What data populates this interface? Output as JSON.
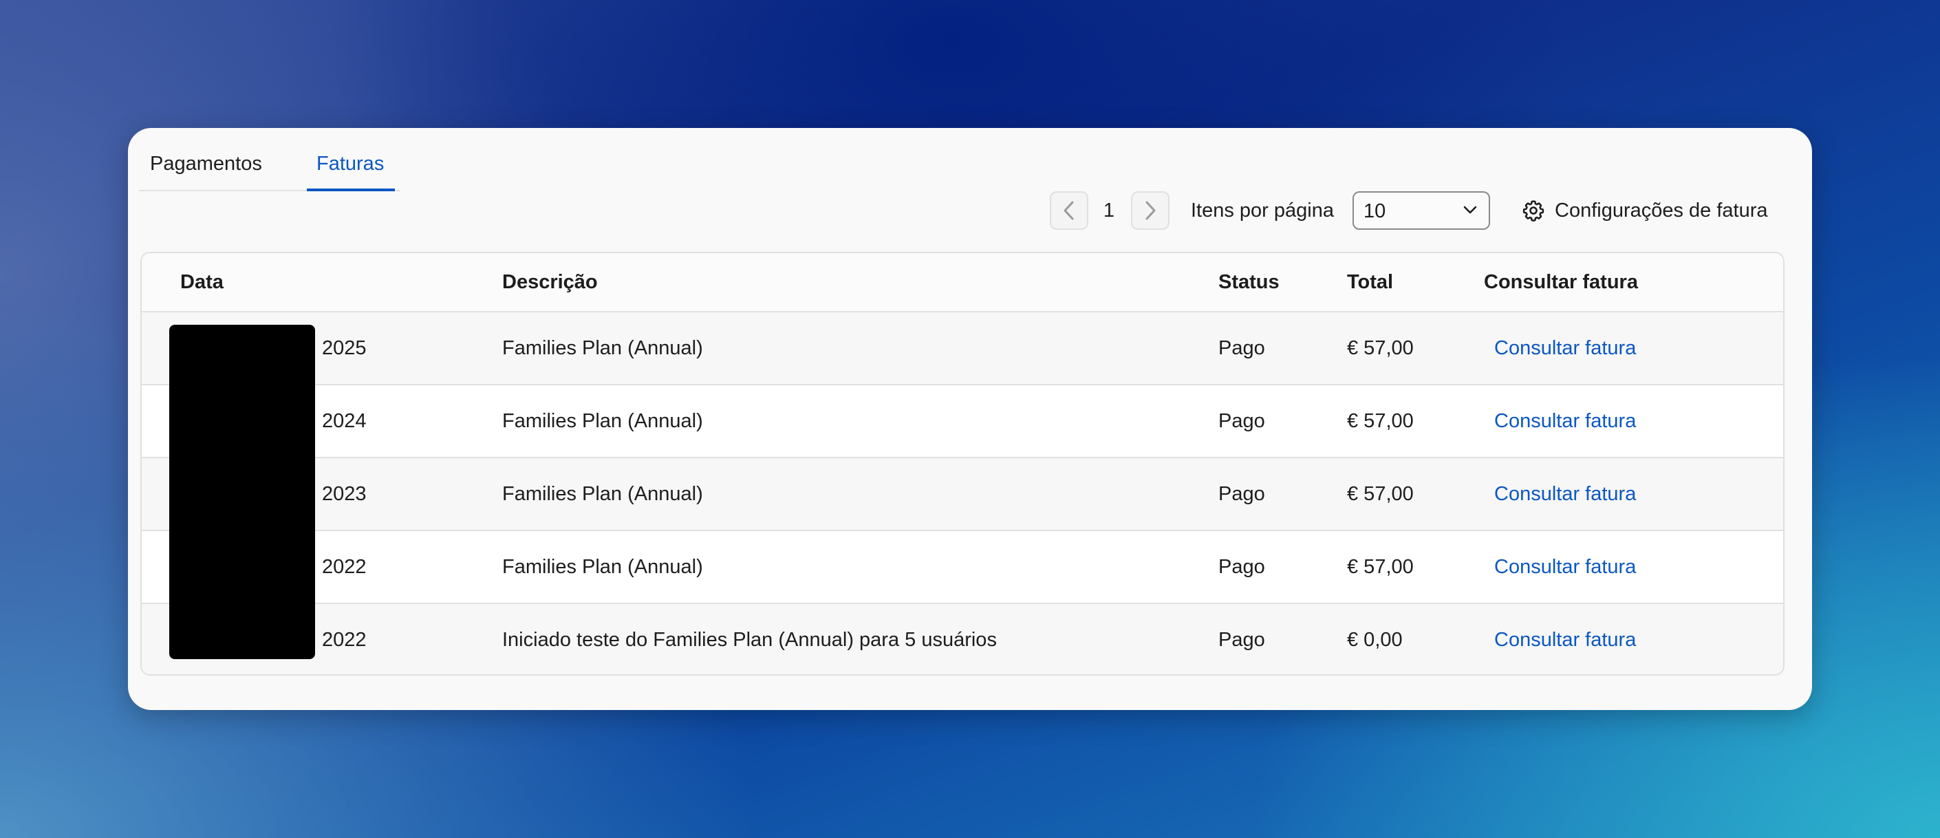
{
  "tabs": [
    {
      "label": "Pagamentos",
      "active": false
    },
    {
      "label": "Faturas",
      "active": true
    }
  ],
  "pagination": {
    "current_page": "1",
    "items_per_page_label": "Itens por página",
    "items_per_page_value": "10"
  },
  "settings": {
    "label": "Configurações de fatura",
    "icon": "gear-icon"
  },
  "table": {
    "headers": {
      "date": "Data",
      "description": "Descrição",
      "status": "Status",
      "total": "Total",
      "invoice": "Consultar fatura"
    },
    "rows": [
      {
        "date": "2025",
        "description": "Families Plan (Annual)",
        "status": "Pago",
        "total": "€ 57,00",
        "link": "Consultar fatura"
      },
      {
        "date": "2024",
        "description": "Families Plan (Annual)",
        "status": "Pago",
        "total": "€ 57,00",
        "link": "Consultar fatura"
      },
      {
        "date": "2023",
        "description": "Families Plan (Annual)",
        "status": "Pago",
        "total": "€ 57,00",
        "link": "Consultar fatura"
      },
      {
        "date": "2022",
        "description": "Families Plan (Annual)",
        "status": "Pago",
        "total": "€ 57,00",
        "link": "Consultar fatura"
      },
      {
        "date": "2022",
        "description": "Iniciado teste do Families Plan (Annual) para 5 usuários",
        "status": "Pago",
        "total": "€ 0,00",
        "link": "Consultar fatura"
      }
    ]
  },
  "colors": {
    "accent": "#0b57c3",
    "text": "#1d1d1d",
    "panel": "#f9f9f9"
  }
}
